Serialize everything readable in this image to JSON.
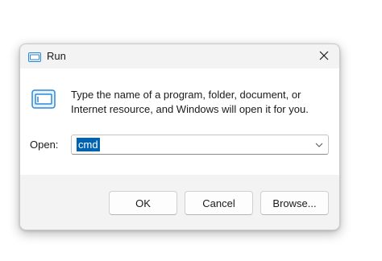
{
  "window": {
    "title": "Run",
    "title_icon": "run-icon",
    "close_icon": "close-icon"
  },
  "content": {
    "icon": "run-icon",
    "description": "Type the name of a program, folder, document, or Internet resource, and Windows will open it for you.",
    "open_label": "Open:",
    "open_value": "cmd",
    "open_value_selected": true,
    "dropdown_icon": "chevron-down-icon"
  },
  "buttons": {
    "ok": "OK",
    "cancel": "Cancel",
    "browse": "Browse..."
  },
  "colors": {
    "selection": "#0063b1",
    "dialog_bg": "#f3f3f3",
    "content_bg": "#ffffff",
    "icon_accent": "#2b88d8"
  }
}
